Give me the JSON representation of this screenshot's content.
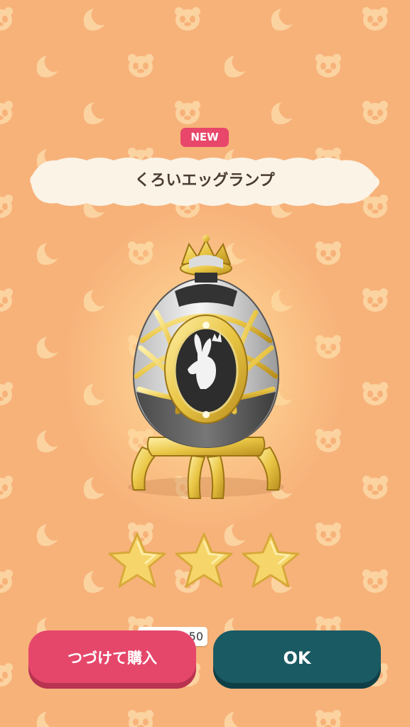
{
  "colors": {
    "background": "#f7b27a",
    "accent_pink": "#e5476b",
    "accent_teal": "#1a5a63",
    "gold": "#f2cf5a"
  },
  "item": {
    "badge": "NEW",
    "name": "くろいエッグランプ",
    "rarity_stars": 3,
    "rarity_max": 3
  },
  "buttons": {
    "buy_again": "つづけて購入",
    "ok": "OK"
  },
  "price": {
    "icon": "ticket-icon",
    "value": "50"
  },
  "icons": {
    "background": [
      "bear-face-icon",
      "moon-crescent-icon"
    ],
    "rarity": "star-icon"
  }
}
